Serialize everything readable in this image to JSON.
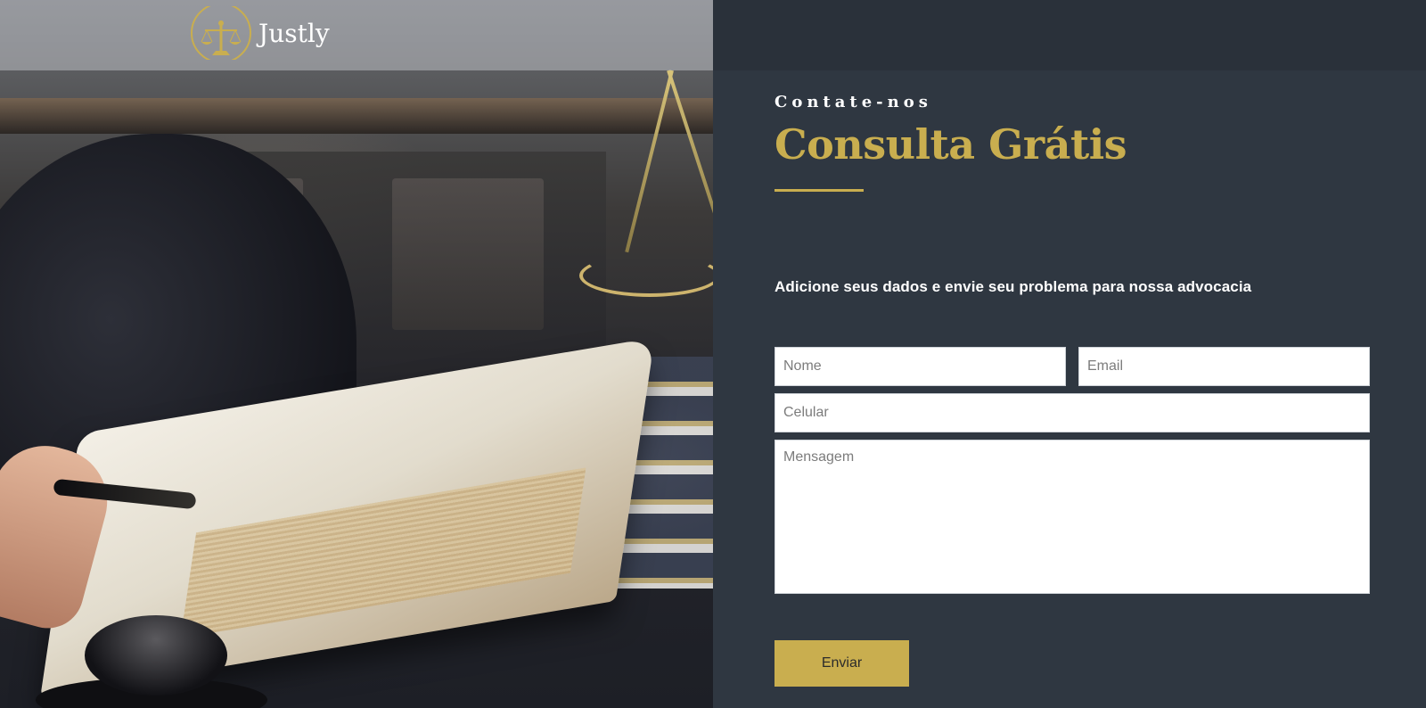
{
  "header": {
    "logo_text": "Justly",
    "logo_icon": "scales-of-justice-icon"
  },
  "hero_image": {
    "subject": "photo"
  },
  "contact": {
    "eyebrow": "Contate-nos",
    "title": "Consulta Grátis",
    "intro": "Adicione seus dados e envie seu problema para nossa advocacia"
  },
  "form": {
    "name_placeholder": "Nome",
    "email_placeholder": "Email",
    "phone_placeholder": "Celular",
    "message_placeholder": "Mensagem",
    "submit_label": "Enviar"
  },
  "colors": {
    "accent": "#c9ae4f",
    "panel_background": "#2f3741",
    "header_background": "#2a313a",
    "text": "#ffffff"
  }
}
